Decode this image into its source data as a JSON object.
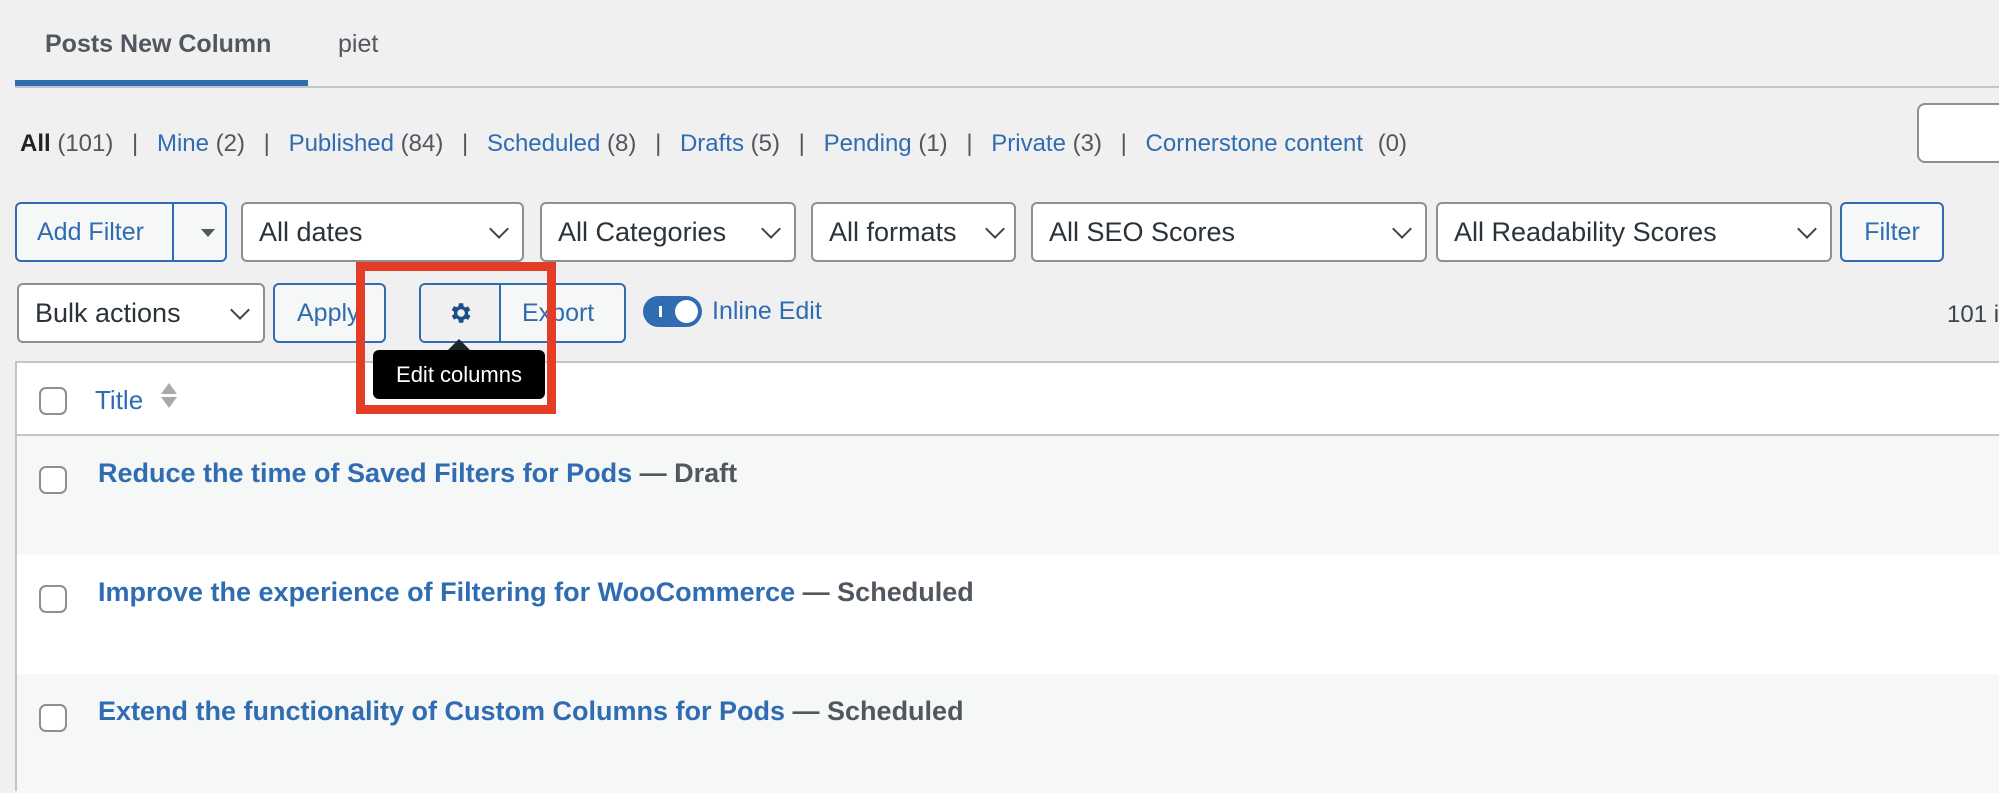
{
  "tabs": [
    {
      "label": "Posts New Column",
      "active": true
    },
    {
      "label": "piet",
      "active": false
    }
  ],
  "status_links": [
    {
      "label": "All",
      "count": "(101)",
      "current": true
    },
    {
      "label": "Mine",
      "count": "(2)",
      "current": false
    },
    {
      "label": "Published",
      "count": "(84)",
      "current": false
    },
    {
      "label": "Scheduled",
      "count": "(8)",
      "current": false
    },
    {
      "label": "Drafts",
      "count": "(5)",
      "current": false
    },
    {
      "label": "Pending",
      "count": "(1)",
      "current": false
    },
    {
      "label": "Private",
      "count": "(3)",
      "current": false
    },
    {
      "label": "Cornerstone content",
      "count": "(0)",
      "current": false
    }
  ],
  "status_separator": "|",
  "filters": {
    "add_filter_label": "Add Filter",
    "dates": "All dates",
    "categories": "All Categories",
    "formats": "All formats",
    "seo": "All SEO Scores",
    "readability": "All Readability Scores",
    "filter_button": "Filter"
  },
  "bulk": {
    "bulk_actions": "Bulk actions",
    "apply": "Apply",
    "export": "Export",
    "inline_edit": "Inline Edit",
    "inline_edit_on": true,
    "item_count": "101 i"
  },
  "tooltip": "Edit columns",
  "table": {
    "columns": [
      "Title"
    ],
    "rows": [
      {
        "title": "Reduce the time of Saved Filters for Pods",
        "state": "— Draft"
      },
      {
        "title": "Improve the experience of Filtering for WooCommerce",
        "state": "— Scheduled"
      },
      {
        "title": "Extend the functionality of Custom Columns for Pods",
        "state": "— Scheduled"
      }
    ]
  },
  "colors": {
    "accent": "#2f6cb2",
    "highlight": "#e43d25",
    "background": "#f0f0f1"
  }
}
